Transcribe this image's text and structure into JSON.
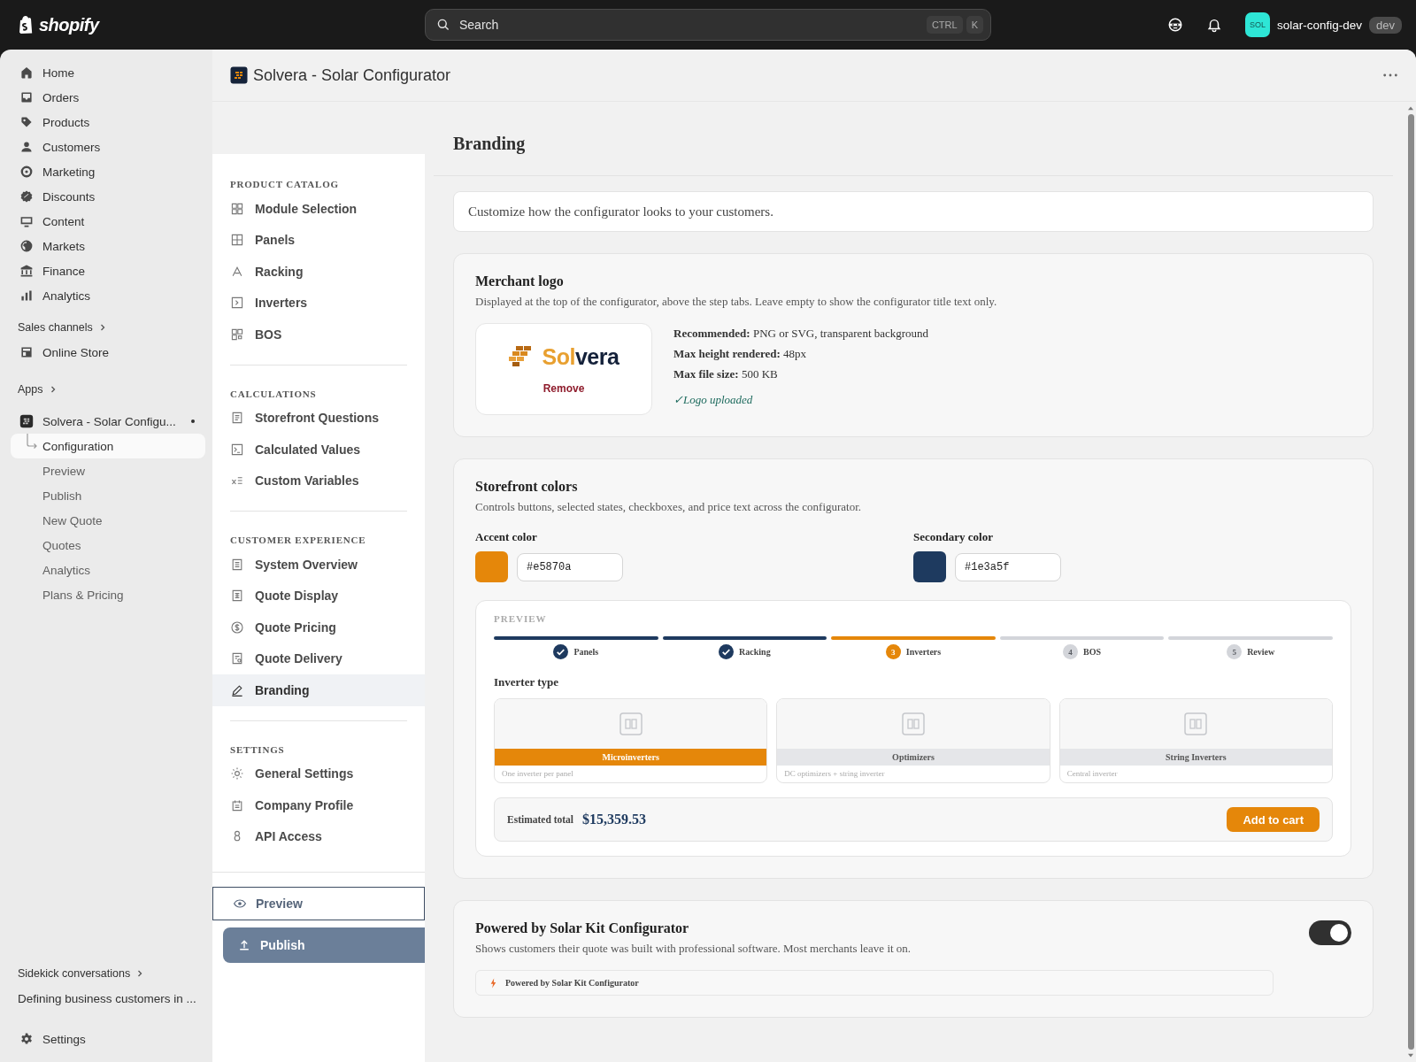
{
  "topbar": {
    "brand": "shopify",
    "search": {
      "placeholder": "Search"
    },
    "shortcut": [
      "CTRL",
      "K"
    ],
    "store_avatar": "SOL",
    "store_name": "solar-config-dev",
    "store_badge": "dev"
  },
  "nav": {
    "items": [
      {
        "label": "Home",
        "selected": false
      },
      {
        "label": "Orders",
        "selected": false
      },
      {
        "label": "Products",
        "selected": false
      },
      {
        "label": "Customers",
        "selected": false
      },
      {
        "label": "Marketing",
        "selected": false
      },
      {
        "label": "Discounts",
        "selected": false
      },
      {
        "label": "Content",
        "selected": false
      },
      {
        "label": "Markets",
        "selected": false
      },
      {
        "label": "Finance",
        "selected": false
      },
      {
        "label": "Analytics",
        "selected": false
      }
    ],
    "sales_channels": "Sales channels",
    "channels": [
      {
        "label": "Online Store",
        "selected": false
      }
    ],
    "apps": "Apps",
    "app": {
      "label": "Solvera - Solar Configu...",
      "pages": [
        {
          "label": "Configuration",
          "selected": true
        },
        {
          "label": "Preview",
          "selected": false
        },
        {
          "label": "Publish",
          "selected": false
        },
        {
          "label": "New Quote",
          "selected": false
        },
        {
          "label": "Quotes",
          "selected": false
        },
        {
          "label": "Analytics",
          "selected": false
        },
        {
          "label": "Plans & Pricing",
          "selected": false
        }
      ]
    },
    "sidekick": "Sidekick conversations",
    "conversation": "Defining business customers in ...",
    "settings": "Settings"
  },
  "header": {
    "title": "Solvera - Solar Configurator"
  },
  "app_sidebar": {
    "sections": [
      {
        "title": "PRODUCT CATALOG",
        "items": [
          {
            "label": "Module Selection",
            "selected": false
          },
          {
            "label": "Panels",
            "selected": false
          },
          {
            "label": "Racking",
            "selected": false
          },
          {
            "label": "Inverters",
            "selected": false
          },
          {
            "label": "BOS",
            "selected": false
          }
        ]
      },
      {
        "title": "CALCULATIONS",
        "items": [
          {
            "label": "Storefront Questions",
            "selected": false
          },
          {
            "label": "Calculated Values",
            "selected": false
          },
          {
            "label": "Custom Variables",
            "selected": false
          }
        ]
      },
      {
        "title": "CUSTOMER EXPERIENCE",
        "items": [
          {
            "label": "System Overview",
            "selected": false
          },
          {
            "label": "Quote Display",
            "selected": false
          },
          {
            "label": "Quote Pricing",
            "selected": false
          },
          {
            "label": "Quote Delivery",
            "selected": false
          },
          {
            "label": "Branding",
            "selected": true
          }
        ]
      },
      {
        "title": "SETTINGS",
        "items": [
          {
            "label": "General Settings",
            "selected": false
          },
          {
            "label": "Company Profile",
            "selected": false
          },
          {
            "label": "API Access",
            "selected": false
          }
        ]
      }
    ],
    "preview_button": "Preview",
    "publish_button": "Publish"
  },
  "page": {
    "title": "Branding",
    "intro": "Customize how the configurator looks to your customers.",
    "logo": {
      "title": "Merchant logo",
      "description": "Displayed at the top of the configurator, above the step tabs. Leave empty to show the configurator title text only.",
      "wordmark": [
        "Sol",
        "vera"
      ],
      "remove": "Remove",
      "specs": [
        "**Recommended:** PNG or SVG, transparent background",
        "**Max height rendered:** 48px",
        "**Max file size:** 500 KB"
      ],
      "status": "✓Logo uploaded"
    },
    "colors": {
      "title": "Storefront colors",
      "description": "Controls buttons, selected states, checkboxes, and price text across the configurator.",
      "items": [
        {
          "label": "Accent color",
          "value": "#e5870a",
          "color": "#e5870a"
        },
        {
          "label": "Secondary color",
          "value": "#1e3a5f",
          "color": "#1e3a5f"
        }
      ],
      "preview": {
        "label": "PREVIEW",
        "steps": [
          {
            "label": "Panels",
            "kind": "done"
          },
          {
            "label": "Racking",
            "kind": "done"
          },
          {
            "label": "Inverters",
            "number": "3",
            "kind": "current"
          },
          {
            "label": "BOS",
            "number": "4",
            "kind": "todo"
          },
          {
            "label": "Review",
            "number": "5",
            "kind": "todo"
          }
        ],
        "question": "Inverter type",
        "options": [
          {
            "label": "Microinverters",
            "description": "One inverter per panel",
            "selected": true
          },
          {
            "label": "Optimizers",
            "description": "DC optimizers + string inverter",
            "selected": false
          },
          {
            "label": "String Inverters",
            "description": "Central inverter",
            "selected": false
          }
        ],
        "total_label": "Estimated total",
        "total": "$15,359.53",
        "cart_button": "Add to cart"
      }
    },
    "powered": {
      "title": "Powered by Solar Kit Configurator",
      "description": "Shows customers their quote was built with professional software. Most merchants leave it on.",
      "on": true,
      "badge": "Powered by Solar Kit Configurator"
    }
  }
}
